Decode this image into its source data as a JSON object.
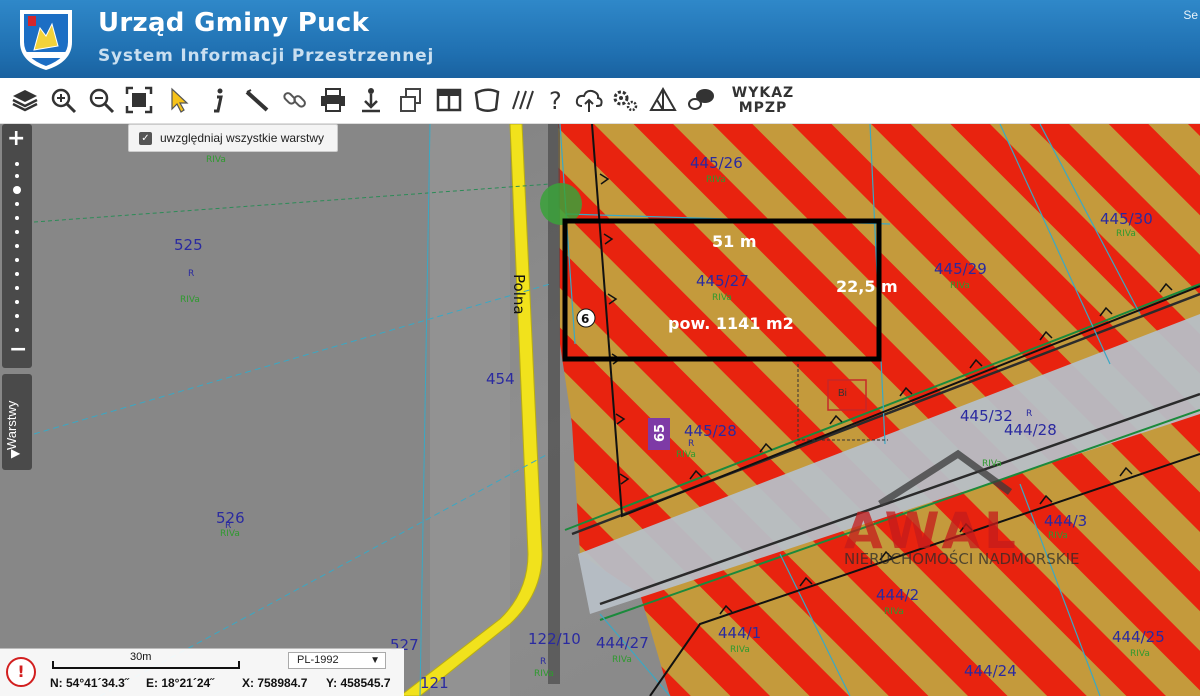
{
  "header": {
    "title": "Urząd Gminy Puck",
    "subtitle": "System Informacji Przestrzennej",
    "right_text": "Se"
  },
  "toolbar": {
    "icons": [
      "layers-icon",
      "zoom-in-icon",
      "zoom-out-icon",
      "full-extent-icon",
      "select-pointer-icon",
      "info-icon",
      "measure-ruler-icon",
      "link-icon",
      "print-icon",
      "download-icon",
      "copy-icon",
      "layout-icon",
      "shape-icon",
      "hatch-icon",
      "help-icon",
      "cloud-upload-icon",
      "settings-icon",
      "triangle-icon",
      "chat-icon"
    ],
    "wykaz_line1": "WYKAZ",
    "wykaz_line2": "MPZP"
  },
  "layers_panel": {
    "label": "Warstwy"
  },
  "checkbox": {
    "label": "uwzględniaj wszystkie warstwy",
    "checked": true
  },
  "map": {
    "parcels": [
      "445/26",
      "445/27",
      "445/29",
      "445/30",
      "445/28",
      "445/32",
      "444/28",
      "525",
      "526",
      "527",
      "454",
      "122/10",
      "121",
      "444/27",
      "444/1",
      "444/2",
      "444/24",
      "444/25",
      "444/3"
    ],
    "land_class": [
      "R",
      "RIVa"
    ],
    "street_name": "Polna",
    "measurements": {
      "width": "51 m",
      "depth": "22,5 m",
      "area": "pow. 1141 m2"
    },
    "markers": {
      "circle_number": "6",
      "purple_number": "65",
      "building_label": "Bi"
    },
    "watermark": {
      "brand": "AWAL",
      "tagline": "NIERUCHOMOŚCI NADMORSKIE"
    },
    "colors": {
      "zone_red": "#e8230f",
      "zone_tan": "#c49a3c",
      "road_yellow": "#f1e21c",
      "outline_black": "#000000"
    }
  },
  "status": {
    "scale_label": "30m",
    "crs": "PL-1992",
    "lat": "N: 54°41´34.3˝",
    "lon": "E: 18°21´24˝",
    "x": "X: 758984.7",
    "y": "Y: 458545.7"
  }
}
